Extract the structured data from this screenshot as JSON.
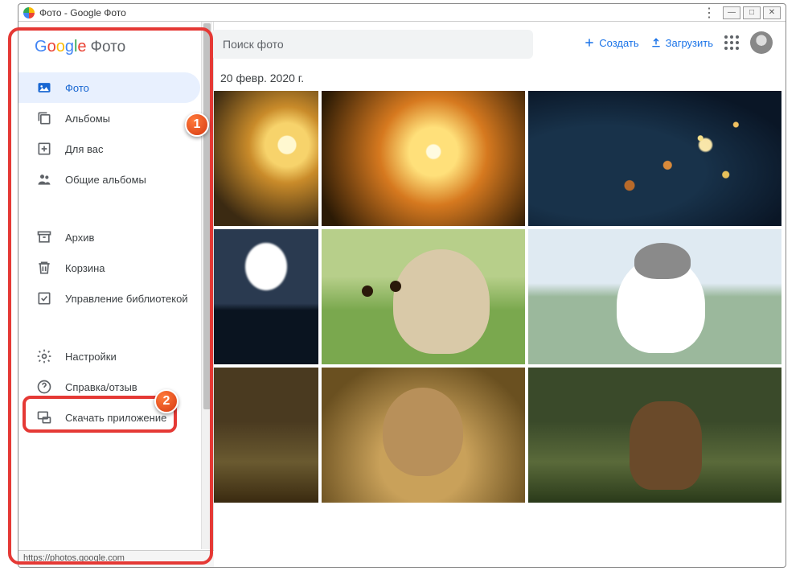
{
  "window": {
    "title": "Фото - Google Фото"
  },
  "brand": {
    "google": "Google",
    "product": "Фото"
  },
  "search": {
    "placeholder": "Поиск фото"
  },
  "actions": {
    "create": "Создать",
    "upload": "Загрузить"
  },
  "nav": {
    "photos": "Фото",
    "albums": "Альбомы",
    "foryou": "Для вас",
    "shared": "Общие альбомы",
    "archive": "Архив",
    "trash": "Корзина",
    "library": "Управление библиотекой",
    "settings": "Настройки",
    "help": "Справка/отзыв",
    "download": "Скачать приложение"
  },
  "grid": {
    "date": "20 февр. 2020 г."
  },
  "status": {
    "url": "https://photos.google.com"
  },
  "badges": {
    "one": "1",
    "two": "2"
  }
}
